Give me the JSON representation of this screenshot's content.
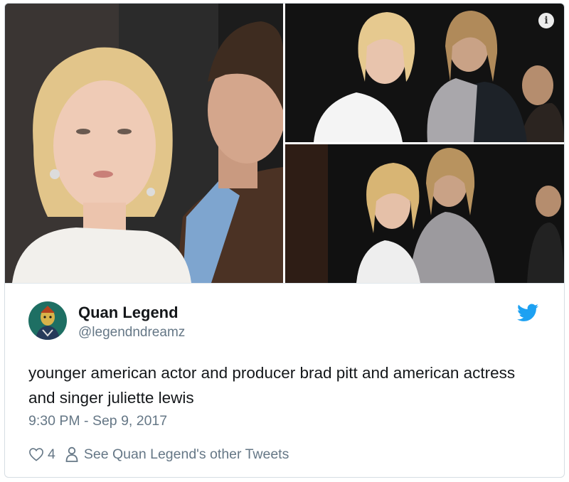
{
  "tweet": {
    "author_name": "Quan Legend",
    "author_handle": "@legendndreamz",
    "text": "younger american actor and producer brad pitt and american actress and singer juliette lewis",
    "timestamp": "9:30 PM - Sep 9, 2017",
    "likes": "4",
    "profile_link_label": "See Quan Legend's other Tweets"
  },
  "icons": {
    "info": "info-icon",
    "brand": "twitter-bird-icon",
    "like": "heart-icon",
    "profile": "person-icon"
  },
  "colors": {
    "twitter_blue": "#1da1f2",
    "secondary_text": "#657786",
    "primary_text": "#14171a",
    "border": "#e1e8ed"
  }
}
